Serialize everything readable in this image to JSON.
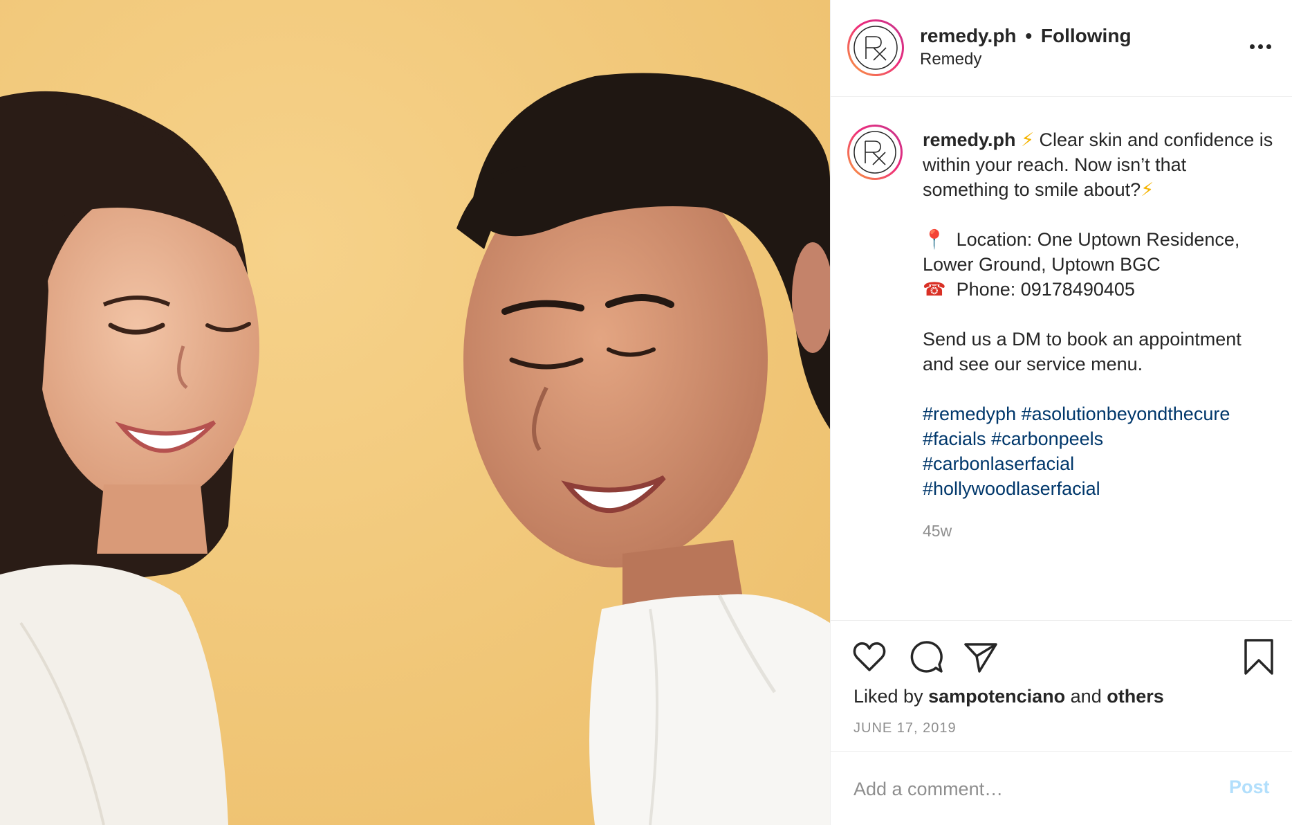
{
  "header": {
    "username": "remedy.ph",
    "separator": "•",
    "follow_status": "Following",
    "subtitle": "Remedy",
    "more_icon": "more-horizontal-icon"
  },
  "caption": {
    "username": "remedy.ph",
    "bolt_emoji": "⚡",
    "line1": "Clear skin and confidence is within your reach. Now isn’t that something to smile about?",
    "pin_emoji": "📍",
    "location": "Location: One Uptown Residence, Lower Ground, Uptown BGC",
    "phone_emoji": "☎",
    "phone": "Phone: 09178490405",
    "cta": "Send us a DM to book an appointment and see our service menu.",
    "hashtags": [
      "#remedyph",
      "#asolutionbeyondthecure",
      "#facials",
      "#carbonpeels",
      "#carbonlaserfacial",
      "#hollywoodlaserfacial"
    ],
    "time_ago": "45w"
  },
  "actions": {
    "icons": [
      "heart-icon",
      "comment-icon",
      "share-icon",
      "bookmark-icon"
    ],
    "liked_prefix": "Liked by",
    "liked_user": "sampotenciano",
    "liked_and": "and",
    "liked_others": "others",
    "date": "JUNE 17, 2019"
  },
  "comment": {
    "placeholder": "Add a comment…",
    "post_label": "Post"
  },
  "colors": {
    "photo_background": "#f2c878",
    "hashtag": "#00376b",
    "post_disabled": "#b2dffc",
    "muted": "#8e8e8e"
  }
}
